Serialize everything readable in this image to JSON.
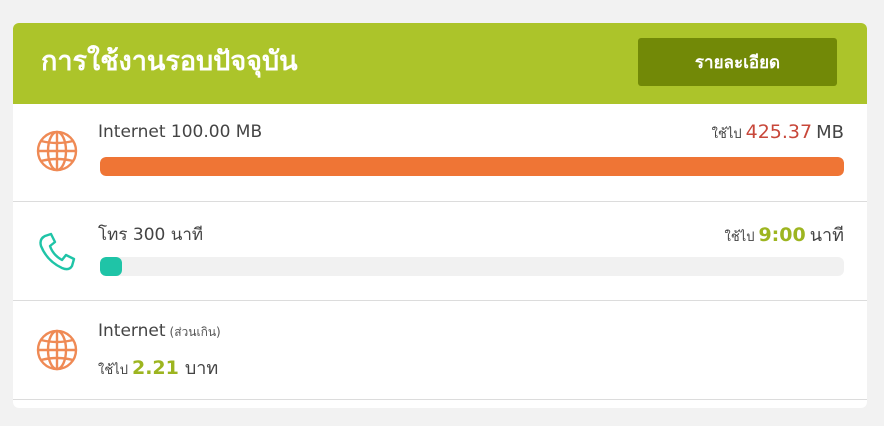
{
  "header": {
    "title": "การใช้งานรอบปัจจุบัน",
    "detail_button": "รายละเอียด"
  },
  "rows": [
    {
      "title": "Internet 100.00 MB",
      "used_prefix": "ใช้ไป",
      "used_value": "425.37",
      "used_unit": "MB",
      "progress": 1.0,
      "bar_color": "#ef7535",
      "icon": "globe-icon",
      "icon_color": "#ef8a55"
    },
    {
      "title": "โทร 300 นาที",
      "used_prefix": "ใช้ไป",
      "used_value": "9:00",
      "used_unit": "นาที",
      "progress": 0.03,
      "bar_color": "#1fc4a7",
      "icon": "phone-icon",
      "icon_color": "#1fc4a7"
    },
    {
      "title": "Internet",
      "title_note": "(ส่วนเกิน)",
      "used_prefix": "ใช้ไป",
      "used_value": "2.21",
      "used_unit": "บาท",
      "icon": "globe-icon",
      "icon_color": "#ef8a55"
    }
  ],
  "colors": {
    "header_bg": "#acc42a",
    "button_bg": "#728907",
    "red_value": "#c8473a",
    "green_value": "#9db520"
  }
}
